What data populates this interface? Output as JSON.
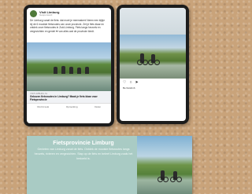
{
  "facebook_post": {
    "page_name": "Visit Limburg",
    "meta": "Gesponsord",
    "body": "De Limburg vanaf de fiets: dat moet je meemaken! Neem een kijkje bij de 6 mooiste fietsroutes van onze provincie. Zet je fiets klaar en ontdek onze fietsroutes in Zuid-Limburg. Fiets langs heuvels en vergezichten en geniet ❤ van alles wat de provincie biedt.",
    "link_url": "VISITLIMBURG.NL",
    "link_title": "Gekozen fietsroutes in Limburg? Maak je fiets klaar voor Fietsprovincie",
    "actions": [
      "Vind ik leuk",
      "Opmerking",
      "Delen"
    ]
  },
  "instagram_post": {
    "actions_icons": [
      "heart-icon",
      "comment-icon",
      "share-icon"
    ],
    "caption": "Be fietslimb"
  },
  "banner": {
    "title": "Fietsprovincie Limburg",
    "body": "Genieten van Limburg vanaf de fiets. Ontdek de mooiste fietsroutes langs heuvels, rivieren en vergezichten. Stap op de fiets en beleef Limburg zoals het bedoeld is."
  },
  "colors": {
    "background": "#c9a37a",
    "banner": "#a9cbc4"
  }
}
